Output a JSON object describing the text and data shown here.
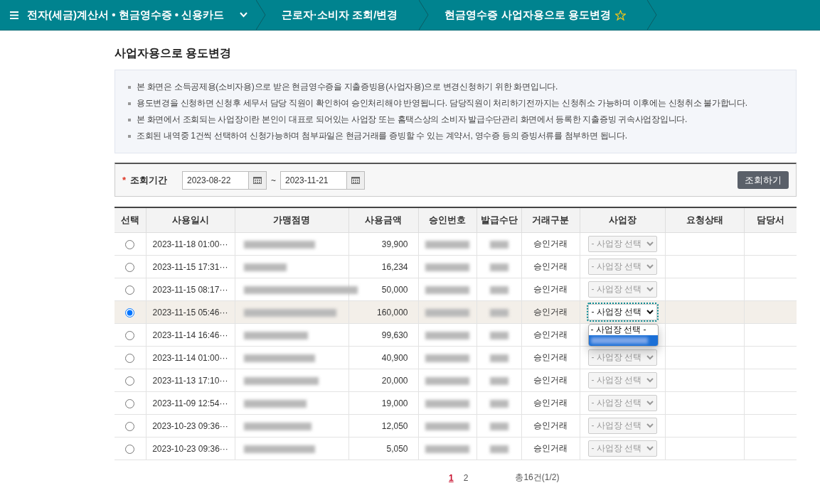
{
  "breadcrumb": {
    "items": [
      {
        "label": "전자(세금)계산서 • 현금영수증 • 신용카드",
        "kind": "dropdown"
      },
      {
        "label": "근로자·소비자 조회/변경",
        "kind": "link"
      },
      {
        "label": "현금영수증 사업자용으로 용도변경",
        "kind": "current",
        "favorite": false
      }
    ]
  },
  "page_title": "사업자용으로 용도변경",
  "notices": [
    "본 화면은 소득공제용(소비자용)으로 받은 현금영수증을 지출증빙용(사업자용)으로 변경신청하기 위한 화면입니다.",
    "용도변경을 신청하면 신청후 세무서 담당 직원이 확인하여 승인처리해야 반영됩니다. 담당직원이 처리하기전까지는 신청취소 가능하며 이후에는 신청취소 불가합니다.",
    "본 화면에서 조회되는 사업장이란 본인이 대표로 되어있는 사업장 또는 홈택스상의 소비자 발급수단관리 화면에서 등록한 지출증빙 귀속사업장입니다.",
    "조회된 내역중 1건씩 선택하여 신청가능하며 첨부파일은 현금거래를 증빙할 수 있는 계약서, 영수증 등의 증빙서류를 첨부하면 됩니다."
  ],
  "search": {
    "label": "조회기간",
    "required_mark": "*",
    "start_date": "2023-08-22",
    "separator": "~",
    "end_date": "2023-11-21",
    "button": "조회하기"
  },
  "table": {
    "columns": [
      "선택",
      "사용일시",
      "가맹점명",
      "사용금액",
      "승인번호",
      "발급수단",
      "거래구분",
      "사업장",
      "요청상태",
      "담당서"
    ],
    "rows": [
      {
        "selected": false,
        "datetime": "2023-11-18 01:00···",
        "amount": "39,900",
        "type": "승인거래",
        "workplace": {
          "value": "- 사업장 선택",
          "disabled": true,
          "open": false
        }
      },
      {
        "selected": false,
        "datetime": "2023-11-15 17:31···",
        "amount": "16,234",
        "type": "승인거래",
        "workplace": {
          "value": "- 사업장 선택",
          "disabled": true,
          "open": false
        }
      },
      {
        "selected": false,
        "datetime": "2023-11-15 08:17···",
        "amount": "50,000",
        "type": "승인거래",
        "workplace": {
          "value": "- 사업장 선택",
          "disabled": true,
          "open": false
        }
      },
      {
        "selected": true,
        "datetime": "2023-11-15 05:46···",
        "amount": "160,000",
        "type": "승인거래",
        "workplace": {
          "value": "- 사업장 선택",
          "disabled": false,
          "open": true,
          "options": [
            {
              "kind": "text",
              "label": "- 사업장 선택 -",
              "highlighted": false
            },
            {
              "kind": "blurred",
              "highlighted": true
            }
          ]
        }
      },
      {
        "selected": false,
        "datetime": "2023-11-14 16:46···",
        "amount": "99,630",
        "type": "승인거래"
      },
      {
        "selected": false,
        "datetime": "2023-11-14 01:00···",
        "amount": "40,900",
        "type": "승인거래",
        "workplace": {
          "value": "- 사업장 선택",
          "disabled": true,
          "open": false
        }
      },
      {
        "selected": false,
        "datetime": "2023-11-13 17:10···",
        "amount": "20,000",
        "type": "승인거래",
        "workplace": {
          "value": "- 사업장 선택",
          "disabled": true,
          "open": false
        }
      },
      {
        "selected": false,
        "datetime": "2023-11-09 12:54···",
        "amount": "19,000",
        "type": "승인거래",
        "workplace": {
          "value": "- 사업장 선택",
          "disabled": true,
          "open": false
        }
      },
      {
        "selected": false,
        "datetime": "2023-10-23 09:36···",
        "amount": "12,050",
        "type": "승인거래",
        "workplace": {
          "value": "- 사업장 선택",
          "disabled": true,
          "open": false
        }
      },
      {
        "selected": false,
        "datetime": "2023-10-23 09:36···",
        "amount": "5,050",
        "type": "승인거래",
        "workplace": {
          "value": "- 사업장 선택",
          "disabled": true,
          "open": false
        }
      }
    ]
  },
  "pagination": {
    "pages": [
      {
        "label": "1",
        "selected": true
      },
      {
        "label": "2",
        "selected": false
      }
    ],
    "total": "총16건(1/2)"
  }
}
